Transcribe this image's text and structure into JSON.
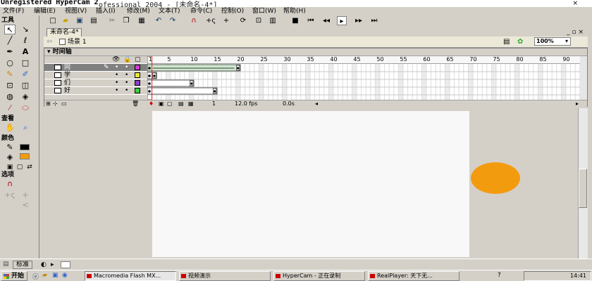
{
  "window": {
    "title_left": "Unregistered HyperCam 2",
    "title_right": "ofessional 2004 - [未命名-4*]",
    "close_glyph": "×"
  },
  "menu": [
    "文件(F)",
    "编辑(E)",
    "视图(V)",
    "插入(I)",
    "修改(M)",
    "文本(T)",
    "命令(C)",
    "控制(O)",
    "窗口(W)",
    "帮助(H)"
  ],
  "toolbar": {
    "buttons": [
      "new-icon",
      "open-icon",
      "save-icon",
      "print-icon",
      "cut-icon",
      "copy-icon",
      "paste-icon",
      "undo-icon",
      "redo-icon",
      "magnet-icon",
      "smooth-icon",
      "straighten-icon",
      "rotate-icon",
      "scale-icon",
      "align-icon"
    ],
    "controls": [
      "stop-icon",
      "rewind-icon",
      "step-back-icon",
      "play-icon",
      "step-forward-icon",
      "go-to-end-icon"
    ]
  },
  "tools_panel": {
    "title": "工具",
    "view_title": "查看",
    "colors_title": "颜色",
    "options_title": "选项"
  },
  "document": {
    "tab_name": "未命名-4*",
    "scene": "场景 1",
    "zoom": "100%",
    "window_controls": "_ ▫ ×"
  },
  "timeline": {
    "title": "时间轴",
    "layers": [
      {
        "name": "同",
        "color": "#d23bd2",
        "active": true,
        "keyframe_at": 20
      },
      {
        "name": "学",
        "color": "#e8e83a",
        "active": false,
        "keyframe_at": 2
      },
      {
        "name": "们",
        "color": "#8e3bd0",
        "active": false,
        "keyframe_at": 10
      },
      {
        "name": "好",
        "color": "#3bd03b",
        "active": false,
        "keyframe_at": 15
      }
    ],
    "ruler_numbers": [
      "1",
      "5",
      "10",
      "15",
      "20",
      "25",
      "30",
      "35",
      "40",
      "45",
      "50",
      "55",
      "60",
      "65",
      "70",
      "75",
      "80",
      "85",
      "90"
    ],
    "current_frame": "1",
    "fps": "12.0 fps",
    "elapsed": "0.0s"
  },
  "stage": {
    "background": "#f8f8f8",
    "circle_color": "#f39b0e"
  },
  "props_bar": {
    "label": "标准"
  },
  "taskbar": {
    "start": "开始",
    "tasks": [
      "Macromedia Flash MX...",
      "视频演示",
      "HyperCam - 正在录制",
      "RealPlayer: 天下无..."
    ],
    "time": "14:41"
  }
}
